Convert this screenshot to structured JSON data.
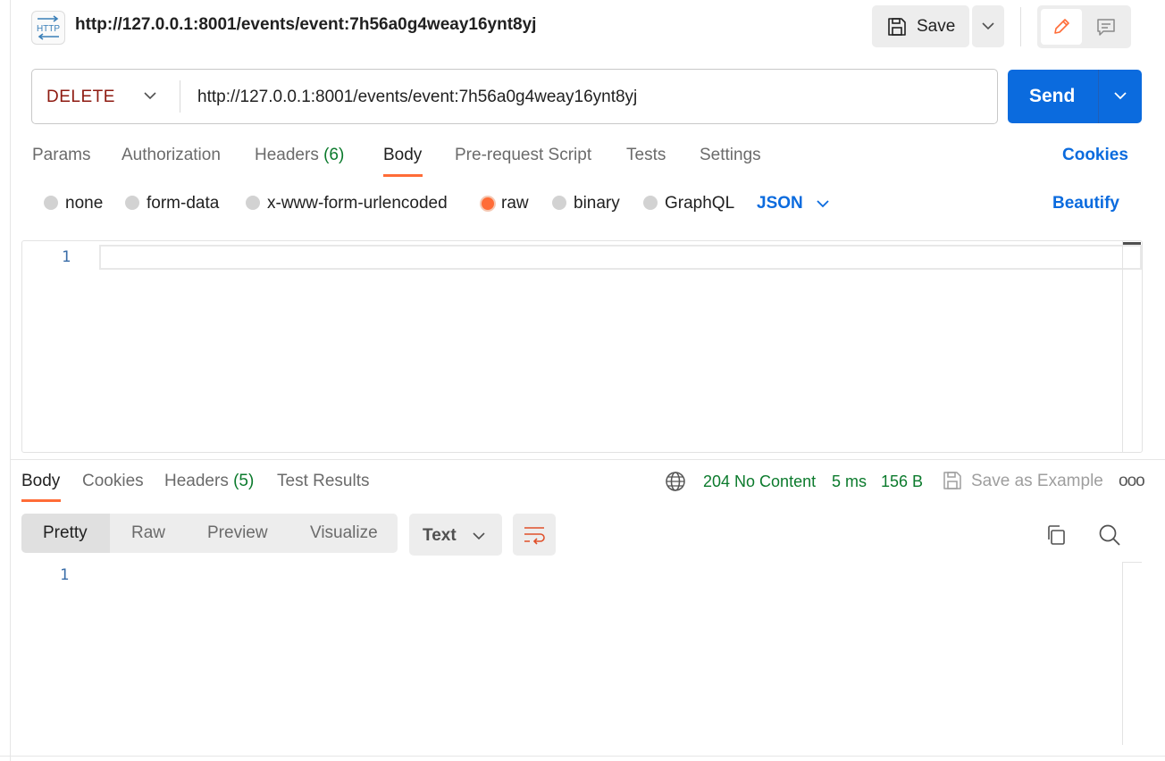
{
  "header": {
    "http_icon_text": "HTTP",
    "title": "http://127.0.0.1:8001/events/event:7h56a0g4weay16ynt8yj",
    "save_label": "Save"
  },
  "request": {
    "method": "DELETE",
    "url": "http://127.0.0.1:8001/events/event:7h56a0g4weay16ynt8yj",
    "send_label": "Send",
    "tabs": {
      "params": "Params",
      "authorization": "Authorization",
      "headers": "Headers",
      "headers_count": "(6)",
      "body": "Body",
      "pre_request_script": "Pre-request Script",
      "tests": "Tests",
      "settings": "Settings"
    },
    "active_tab": "Body",
    "cookies_label": "Cookies",
    "body_types": {
      "none": "none",
      "form_data": "form-data",
      "x_www_form_urlencoded": "x-www-form-urlencoded",
      "raw": "raw",
      "binary": "binary",
      "graphql": "GraphQL"
    },
    "selected_body_type": "raw",
    "raw_format": "JSON",
    "beautify_label": "Beautify",
    "editor_line_number": "1"
  },
  "response": {
    "tabs": {
      "body": "Body",
      "cookies": "Cookies",
      "headers": "Headers",
      "headers_count": "(5)",
      "test_results": "Test Results"
    },
    "active_tab": "Body",
    "status": "204 No Content",
    "time": "5 ms",
    "size": "156 B",
    "save_as_example_label": "Save as Example",
    "more_label": "ooo",
    "view_modes": {
      "pretty": "Pretty",
      "raw": "Raw",
      "preview": "Preview",
      "visualize": "Visualize"
    },
    "active_view_mode": "Pretty",
    "format": "Text",
    "editor_line_number": "1"
  },
  "colors": {
    "accent_orange": "#ff6c37",
    "send_blue": "#0b6bde",
    "status_green": "#0b7a2c",
    "method_delete": "#8e1a10"
  }
}
